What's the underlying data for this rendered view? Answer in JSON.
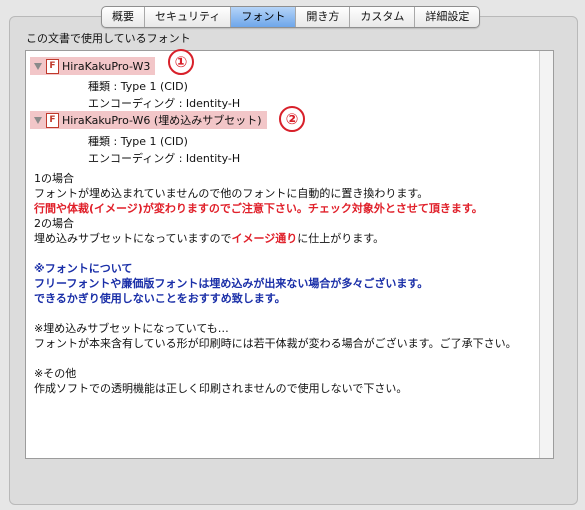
{
  "tabs": [
    {
      "label": "概要"
    },
    {
      "label": "セキュリティ"
    },
    {
      "label": "フォント",
      "active": true
    },
    {
      "label": "開き方"
    },
    {
      "label": "カスタム"
    },
    {
      "label": "詳細設定"
    }
  ],
  "section_title": "この文書で使用しているフォント",
  "fonts": [
    {
      "name": "HiraKakuPro-W3",
      "badge": "①",
      "type": "種類 : Type 1 (CID)",
      "encoding": "エンコーディング : Identity-H"
    },
    {
      "name": "HiraKakuPro-W6 (埋め込みサブセット)",
      "badge": "②",
      "type": "種類 : Type 1 (CID)",
      "encoding": "エンコーディング : Identity-H"
    }
  ],
  "notes": {
    "case1_title": "1の場合",
    "case1_line1": "フォントが埋め込まれていませんので他のフォントに自動的に置き換わります。",
    "case1_line2": "行間や体裁(イメージ)が変わりますのでご注意下さい。チェック対象外とさせて頂きます。",
    "case2_title": "2の場合",
    "case2_pre": "埋め込みサブセットになっていますので",
    "case2_red": "イメージ通り",
    "case2_post": "に仕上がります。",
    "font_note_title": "※フォントについて",
    "font_note_line1": "フリーフォントや廉価版フォントは埋め込みが出来ない場合が多々ございます。",
    "font_note_line2": "できるかぎり使用しないことをおすすめ致します。",
    "subset_note_title": "※埋め込みサブセットになっていても…",
    "subset_note_line1": "フォントが本来含有している形が印刷時には若干体裁が変わる場合がございます。ご了承下さい。",
    "other_title": "※その他",
    "other_line1": "作成ソフトでの透明機能は正しく印刷されませんので使用しないで下さい。"
  },
  "colors": {
    "accent_red": "#e0202a",
    "note_blue": "#1a2fa8",
    "highlight": "#f2c6c8"
  }
}
